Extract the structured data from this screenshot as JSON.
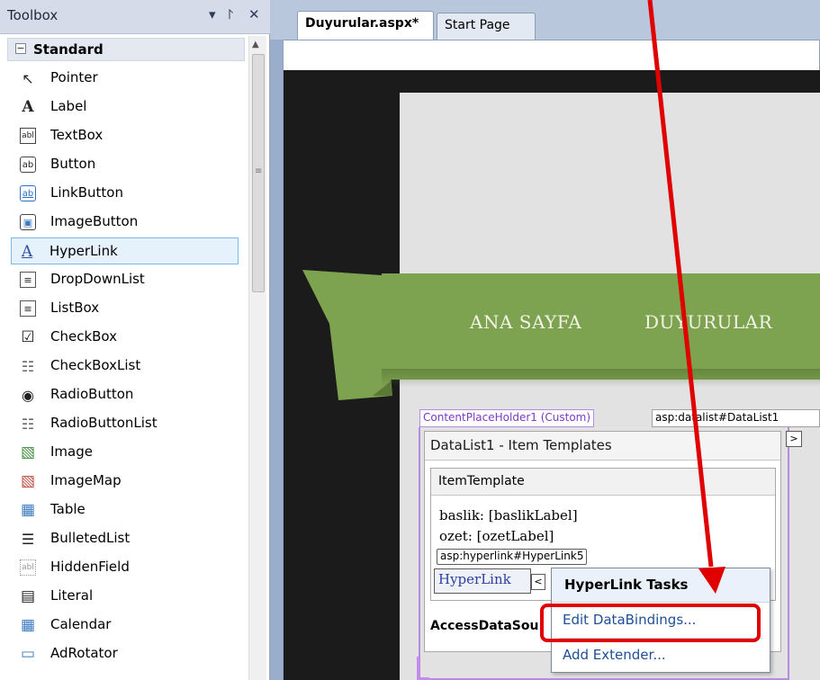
{
  "toolbox": {
    "title": "Toolbox",
    "pin_icon": "▾",
    "autohide_icon": "⨡",
    "close_icon": "✕",
    "section": "Standard",
    "collapse_glyph": "−",
    "items": [
      {
        "label": "Pointer",
        "icon": "↖"
      },
      {
        "label": "Label",
        "icon": "A"
      },
      {
        "label": "TextBox",
        "icon": "abl"
      },
      {
        "label": "Button",
        "icon": "ab"
      },
      {
        "label": "LinkButton",
        "icon": "ab"
      },
      {
        "label": "ImageButton",
        "icon": "▣"
      },
      {
        "label": "HyperLink",
        "icon": "A"
      },
      {
        "label": "DropDownList",
        "icon": "≡"
      },
      {
        "label": "ListBox",
        "icon": "≡"
      },
      {
        "label": "CheckBox",
        "icon": "☑"
      },
      {
        "label": "CheckBoxList",
        "icon": "☷"
      },
      {
        "label": "RadioButton",
        "icon": "◉"
      },
      {
        "label": "RadioButtonList",
        "icon": "☷"
      },
      {
        "label": "Image",
        "icon": "▧"
      },
      {
        "label": "ImageMap",
        "icon": "▧"
      },
      {
        "label": "Table",
        "icon": "▦"
      },
      {
        "label": "BulletedList",
        "icon": "☰"
      },
      {
        "label": "HiddenField",
        "icon": "abl"
      },
      {
        "label": "Literal",
        "icon": "▤"
      },
      {
        "label": "Calendar",
        "icon": "▦"
      },
      {
        "label": "AdRotator",
        "icon": "▭"
      }
    ],
    "selected_item": "HyperLink"
  },
  "tabs": [
    {
      "label": "Duyurular.aspx*",
      "active": true
    },
    {
      "label": "Start Page",
      "active": false
    }
  ],
  "page": {
    "nav_home": "ANA SAYFA",
    "nav_announcements": "DUYURULAR",
    "banner_color": "#7da250",
    "background_color": "#1b1b1b"
  },
  "designer": {
    "placeholder_tag": "ContentPlaceHolder1 (Custom)",
    "datalist_tag": "asp:datalist#DataList1",
    "datalist_title": "DataList1 - Item Templates",
    "item_template_label": "ItemTemplate",
    "line_baslik": "baslik: [baslikLabel]",
    "line_ozet": "ozet: [ozetLabel]",
    "hyperlink_tag": "asp:hyperlink#HyperLink5",
    "hyperlink_text": "HyperLink",
    "datasource_label": "AccessDataSou",
    "smart_tag_glyph": "<",
    "expand_glyph": ">"
  },
  "tasks_menu": {
    "title": "HyperLink Tasks",
    "items": [
      "Edit DataBindings...",
      "Add Extender..."
    ]
  },
  "annotation": {
    "color": "#e00000"
  }
}
